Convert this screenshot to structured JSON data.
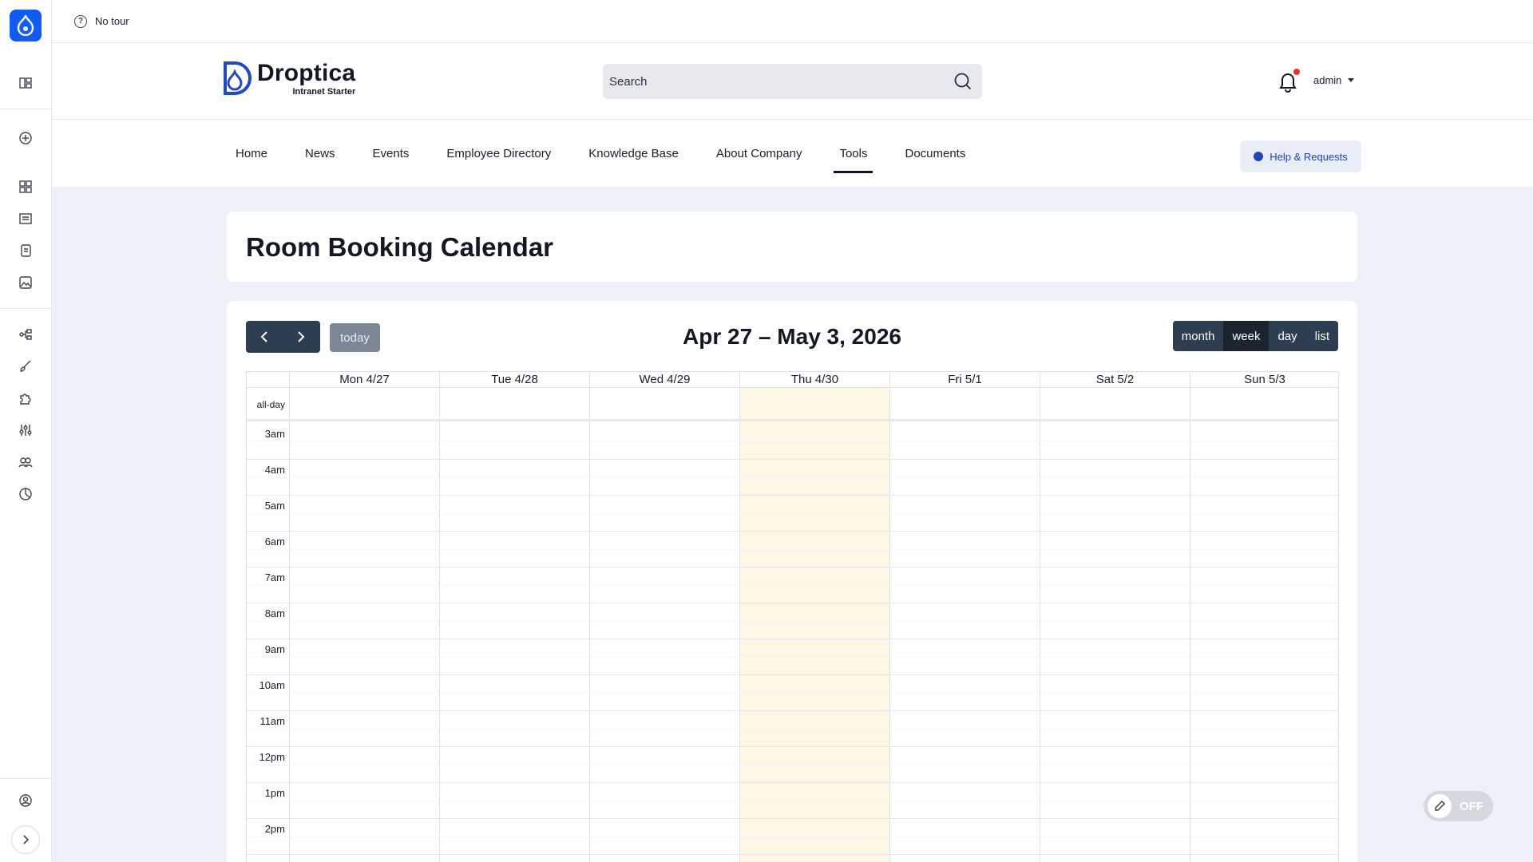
{
  "tour": {
    "label": "No tour"
  },
  "logo": {
    "name": "Droptica",
    "subtitle": "Intranet Starter"
  },
  "search": {
    "placeholder": "Search"
  },
  "user": {
    "name": "admin"
  },
  "nav": {
    "items": [
      "Home",
      "News",
      "Events",
      "Employee Directory",
      "Knowledge Base",
      "About Company",
      "Tools",
      "Documents"
    ],
    "active": "Tools",
    "help_label": "Help & Requests"
  },
  "page": {
    "title": "Room Booking Calendar"
  },
  "calendar": {
    "range_title": "Apr 27 – May 3, 2026",
    "today_label": "today",
    "views": [
      "month",
      "week",
      "day",
      "list"
    ],
    "active_view": "week",
    "days": [
      "Mon 4/27",
      "Tue 4/28",
      "Wed 4/29",
      "Thu 4/30",
      "Fri 5/1",
      "Sat 5/2",
      "Sun 5/3"
    ],
    "today_day": "Thu 4/30",
    "allday_label": "all-day",
    "times": [
      "3am",
      "4am",
      "5am",
      "6am",
      "7am",
      "8am",
      "9am",
      "10am",
      "11am",
      "12pm",
      "1pm",
      "2pm"
    ]
  },
  "edit_toggle": {
    "label": "OFF"
  },
  "colors": {
    "accent": "#0f5df5",
    "button_dark": "#2c3e50",
    "today_highlight": "#fcf8e3",
    "help_text": "#2443b8"
  }
}
